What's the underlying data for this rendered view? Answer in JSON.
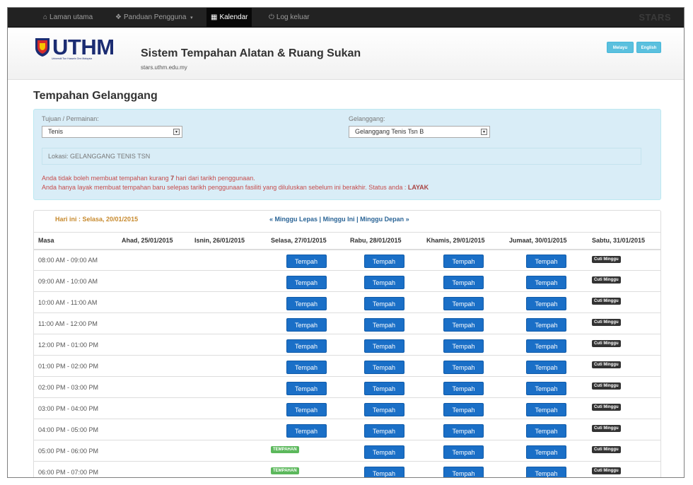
{
  "navbar": {
    "home": "Laman utama",
    "guide": "Panduan Pengguna",
    "calendar": "Kalendar",
    "logout": "Log keluar",
    "brand": "STARS"
  },
  "header": {
    "logo_text": "UTHM",
    "logo_subtext": "Universiti Tun Hussein Onn Malaysia",
    "title": "Sistem Tempahan Alatan & Ruang Sukan",
    "subtitle": "stars.uthm.edu.my",
    "lang_my": "Melayu",
    "lang_en": "English"
  },
  "page": {
    "title": "Tempahan Gelanggang"
  },
  "filter": {
    "purpose_label": "Tujuan / Permainan:",
    "purpose_value": "Tenis",
    "court_label": "Gelanggang:",
    "court_value": "Gelanggang Tenis Tsn B",
    "location": "Lokasi: GELANGGANG TENIS TSN",
    "warn1_pre": "Anda tidak boleh membuat tempahan kurang ",
    "warn1_num": "7",
    "warn1_post": " hari dari tarikh penggunaan.",
    "warn2_pre": "Anda hanya layak membuat tempahan baru selepas tarikh penggunaan fasiliti yang diluluskan sebelum ini berakhir. Status anda : ",
    "warn2_status": "LAYAK"
  },
  "calendar": {
    "today": "Hari ini : Selasa, 20/01/2015",
    "prev_week": "« Minggu Lepas",
    "this_week": "Minggu Ini",
    "next_week": "Minggu Depan »",
    "separator": "|",
    "book_label": "Tempah",
    "off_label": "Cuti Minggu",
    "booked_label": "TEMPAHAN",
    "headers": [
      "Masa",
      "Ahad, 25/01/2015",
      "Isnin, 26/01/2015",
      "Selasa, 27/01/2015",
      "Rabu, 28/01/2015",
      "Khamis, 29/01/2015",
      "Jumaat, 30/01/2015",
      "Sabtu, 31/01/2015"
    ],
    "rows": [
      {
        "time": "08:00 AM - 09:00 AM",
        "cells": [
          "",
          "",
          "book",
          "book",
          "book",
          "book",
          "off"
        ]
      },
      {
        "time": "09:00 AM - 10:00 AM",
        "cells": [
          "",
          "",
          "book",
          "book",
          "book",
          "book",
          "off"
        ]
      },
      {
        "time": "10:00 AM - 11:00 AM",
        "cells": [
          "",
          "",
          "book",
          "book",
          "book",
          "book",
          "off"
        ]
      },
      {
        "time": "11:00 AM - 12:00 PM",
        "cells": [
          "",
          "",
          "book",
          "book",
          "book",
          "book",
          "off"
        ]
      },
      {
        "time": "12:00 PM - 01:00 PM",
        "cells": [
          "",
          "",
          "book",
          "book",
          "book",
          "book",
          "off"
        ]
      },
      {
        "time": "01:00 PM - 02:00 PM",
        "cells": [
          "",
          "",
          "book",
          "book",
          "book",
          "book",
          "off"
        ]
      },
      {
        "time": "02:00 PM - 03:00 PM",
        "cells": [
          "",
          "",
          "book",
          "book",
          "book",
          "book",
          "off"
        ]
      },
      {
        "time": "03:00 PM - 04:00 PM",
        "cells": [
          "",
          "",
          "book",
          "book",
          "book",
          "book",
          "off"
        ]
      },
      {
        "time": "04:00 PM - 05:00 PM",
        "cells": [
          "",
          "",
          "book",
          "book",
          "book",
          "book",
          "off"
        ]
      },
      {
        "time": "05:00 PM - 06:00 PM",
        "cells": [
          "",
          "",
          "booked",
          "book",
          "book",
          "book",
          "off"
        ]
      },
      {
        "time": "06:00 PM - 07:00 PM",
        "cells": [
          "",
          "",
          "booked",
          "book",
          "book",
          "book",
          "off"
        ]
      }
    ]
  },
  "colors": {
    "navbar_bg": "#222222",
    "panel_bg": "#d9edf7",
    "book_button": "#1a6fc7",
    "warning_text": "#c64c4c",
    "today_text": "#c78a2e",
    "booked_label": "#5cb85c",
    "off_label": "#333333"
  },
  "icons": {
    "home": "home-icon",
    "guide": "info-circle-icon",
    "calendar": "calendar-icon",
    "logout": "power-icon",
    "dropdown": "caret-down-icon"
  }
}
